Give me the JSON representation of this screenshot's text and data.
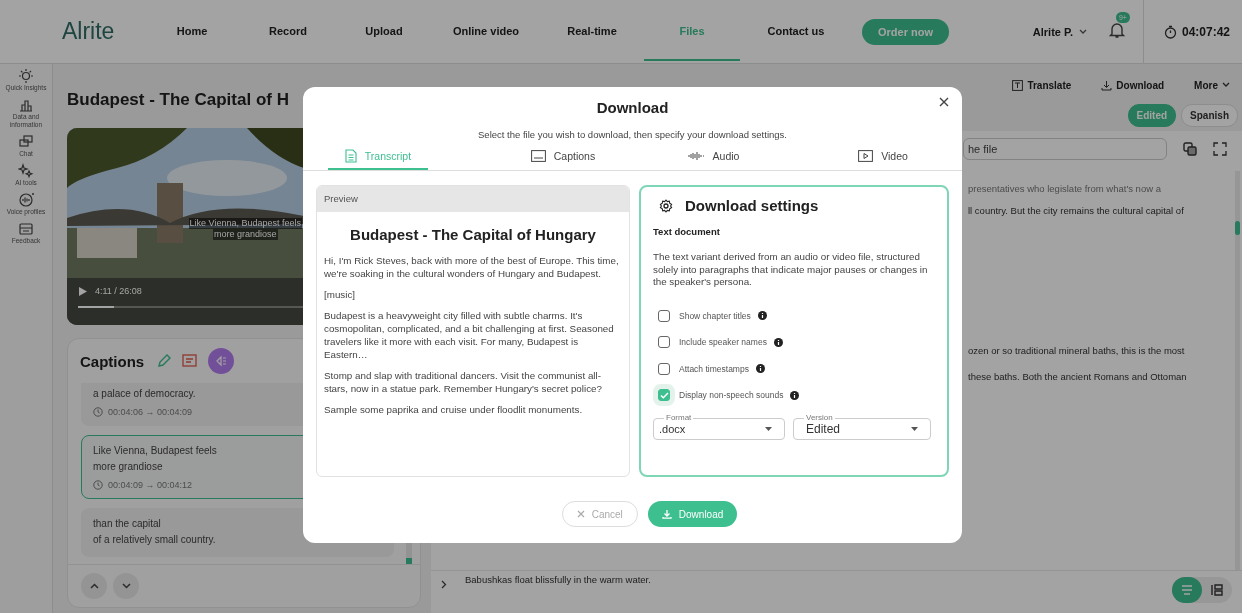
{
  "nav": {
    "logo": "Alrite",
    "items": [
      {
        "label": "Home",
        "selected": false
      },
      {
        "label": "Record",
        "selected": false
      },
      {
        "label": "Upload",
        "selected": false
      },
      {
        "label": "Online video",
        "selected": false
      },
      {
        "label": "Real-time",
        "selected": false
      },
      {
        "label": "Files",
        "selected": true
      },
      {
        "label": "Contact us",
        "selected": false
      }
    ],
    "cta": "Order now",
    "user": "Alrite P.",
    "badge": "9+",
    "timer": "04:07:42"
  },
  "sidebar": {
    "items": [
      {
        "label": "Quick Insights"
      },
      {
        "label": "Data and information"
      },
      {
        "label": "Chat"
      },
      {
        "label": "AI tools"
      },
      {
        "label": "Voice profiles"
      },
      {
        "label": "Feedback"
      }
    ]
  },
  "file": {
    "title": "Budapest - The Capital of H",
    "video": {
      "subtitle_lines": [
        "Like Vienna, Budapest feels",
        "more grandiose"
      ],
      "time": "4:11 / 26:08",
      "level": 0.16
    }
  },
  "captions": {
    "title": "Captions",
    "items": [
      {
        "lines": [
          "a palace of democracy."
        ],
        "time": "00:04:06 → 00:04:09",
        "selected": false
      },
      {
        "lines": [
          "Like Vienna, Budapest feels",
          "more grandiose"
        ],
        "time": "00:04:09 → 00:04:12",
        "selected": true
      },
      {
        "lines": [
          "than the capital",
          "of a relatively small country."
        ],
        "selected": false
      }
    ]
  },
  "right_panel": {
    "actions": [
      "Translate",
      "Download",
      "More"
    ],
    "versions": [
      {
        "label": "Edited",
        "selected": true
      },
      {
        "label": "Spanish",
        "selected": false
      }
    ],
    "search": {
      "placeholder": "he file"
    },
    "transcript_lines": [
      {
        "text": "presentatives who legislate from what's now a",
        "kind": "past"
      },
      {
        "text": "ll country. But the city remains the cultural capital of",
        "kind": "current"
      },
      {
        "text": "ozen or so traditional mineral baths, this is the most",
        "kind": "current"
      },
      {
        "text": "these baths. Both the ancient Romans and Ottoman",
        "kind": "current"
      }
    ],
    "last_line": "Babushkas float blissfully in the warm water.",
    "view_modes": [
      {
        "selected": true
      },
      {
        "selected": false
      }
    ]
  },
  "dialog": {
    "title": "Download",
    "subtitle": "Select the file you wish to download, then specify your download settings.",
    "tabs": [
      {
        "label": "Transcript",
        "selected": true
      },
      {
        "label": "Captions",
        "selected": false
      },
      {
        "label": "Audio",
        "selected": false
      },
      {
        "label": "Video",
        "selected": false
      }
    ],
    "preview": {
      "header": "Preview",
      "heading": "Budapest - The Capital of Hungary",
      "paragraphs": [
        "Hi, I'm Rick Steves, back with more of the best of Europe. This time, we're soaking in the cultural wonders of Hungary and Budapest.",
        "[music]",
        "Budapest is a heavyweight city filled with subtle charms. It's cosmopolitan, complicated, and a bit challenging at first. Seasoned travelers like it more with each visit. For many, Budapest is Eastern…",
        "Stomp and slap with traditional dancers. Visit the communist all-stars, now in a statue park. Remember Hungary's secret police?",
        "Sample some paprika and cruise under floodlit monuments."
      ]
    },
    "settings": {
      "title": "Download settings",
      "subtitle": "Text document",
      "description": "The text variant derived from an audio or video file, structured solely into paragraphs that indicate major pauses or changes in the speaker's persona.",
      "options": [
        {
          "label": "Show chapter titles",
          "checked": false
        },
        {
          "label": "Include speaker names",
          "checked": false
        },
        {
          "label": "Attach timestamps",
          "checked": false
        },
        {
          "label": "Display non-speech sounds",
          "checked": true
        }
      ],
      "selects": [
        {
          "label": "Format",
          "value": ".docx"
        },
        {
          "label": "Version",
          "value": "Edited"
        }
      ]
    },
    "buttons": [
      {
        "label": "Cancel",
        "kind": "secondary"
      },
      {
        "label": "Download",
        "kind": "primary"
      }
    ]
  }
}
